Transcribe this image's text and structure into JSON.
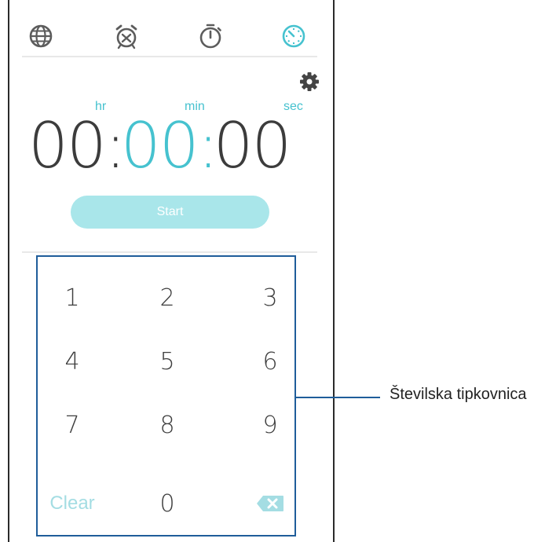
{
  "tabs": [
    {
      "name": "world-clock",
      "icon": "globe-icon"
    },
    {
      "name": "alarm",
      "icon": "alarm-clock-icon"
    },
    {
      "name": "stopwatch",
      "icon": "stopwatch-icon"
    },
    {
      "name": "timer",
      "icon": "timer-icon",
      "active": true
    }
  ],
  "settings_icon": "gear-icon",
  "units": {
    "hr": "hr",
    "min": "min",
    "sec": "sec"
  },
  "time": {
    "hours": "00",
    "minutes": "00",
    "seconds": "00",
    "separator": ":"
  },
  "start_label": "Start",
  "keypad": {
    "keys": [
      "1",
      "2",
      "3",
      "4",
      "5",
      "6",
      "7",
      "8",
      "9"
    ],
    "clear_label": "Clear",
    "zero": "0",
    "backspace_icon": "backspace-icon"
  },
  "callout": {
    "label": "Številska tipkovnica"
  },
  "colors": {
    "accent": "#46c2cf",
    "start_button": "#a9e6ea",
    "clear_text": "#a4dde3",
    "callout_line": "#1f5d9a"
  }
}
